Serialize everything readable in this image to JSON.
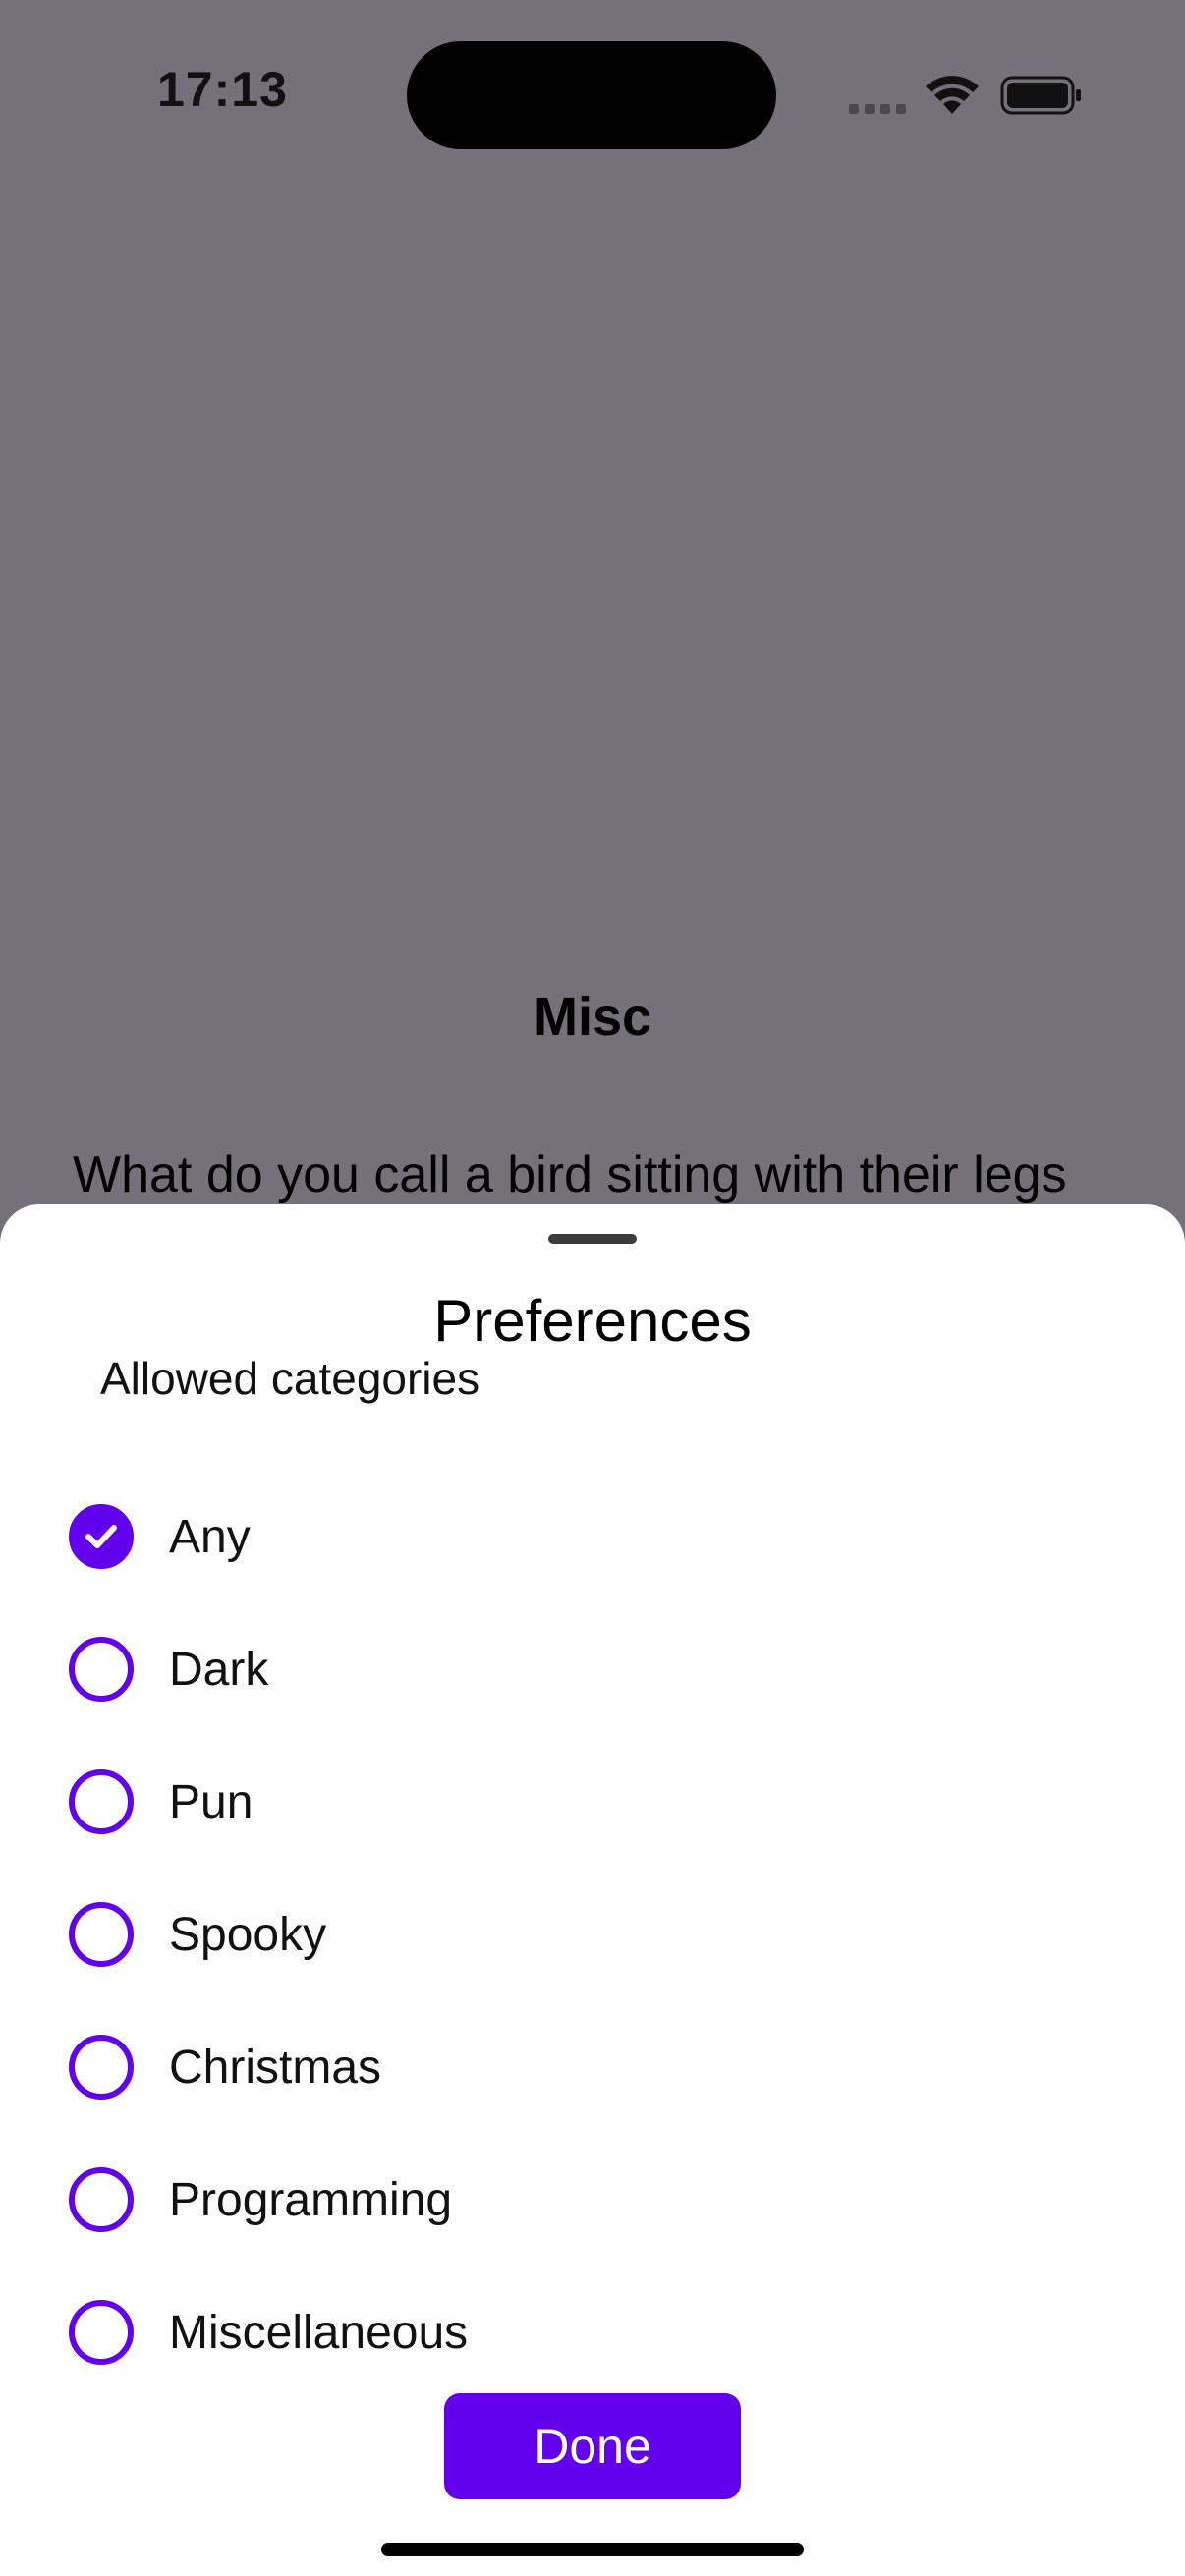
{
  "status_bar": {
    "time": "17:13"
  },
  "background": {
    "category_title": "Misc",
    "joke_text": "What do you call a bird sitting with their legs"
  },
  "sheet": {
    "title": "Preferences",
    "section_label": "Allowed categories",
    "options": [
      {
        "label": "Any",
        "checked": true
      },
      {
        "label": "Dark",
        "checked": false
      },
      {
        "label": "Pun",
        "checked": false
      },
      {
        "label": "Spooky",
        "checked": false
      },
      {
        "label": "Christmas",
        "checked": false
      },
      {
        "label": "Programming",
        "checked": false
      },
      {
        "label": "Miscellaneous",
        "checked": false
      }
    ],
    "done_label": "Done"
  },
  "colors": {
    "accent": "#6200ee",
    "dim_background": "#757079"
  },
  "icons": {
    "wifi": "wifi-icon",
    "battery": "battery-icon",
    "check": "checkmark-icon"
  }
}
